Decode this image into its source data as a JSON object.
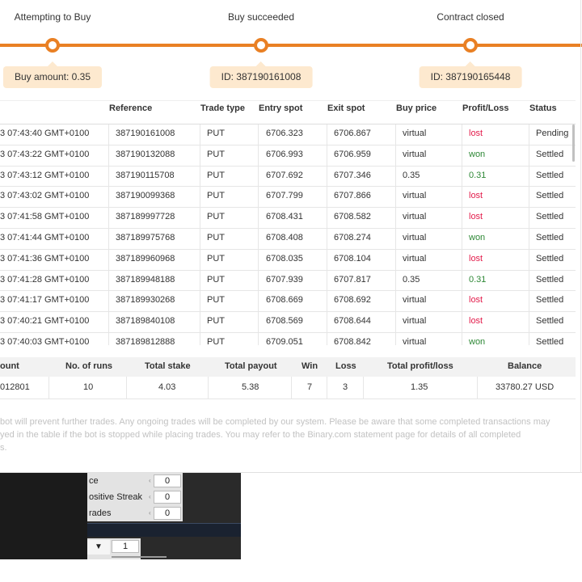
{
  "tracker": {
    "steps": [
      {
        "title": "Attempting to Buy",
        "bubble": "Buy amount: 0.35"
      },
      {
        "title": "Buy succeeded",
        "bubble": "ID: 387190161008"
      },
      {
        "title": "Contract closed",
        "bubble": "ID: 387190165448"
      }
    ],
    "accent_color": "#e98024"
  },
  "transactions": {
    "headers": [
      "Reference",
      "Trade type",
      "Entry spot",
      "Exit spot",
      "Buy price",
      "Profit/Loss",
      "Status"
    ],
    "rows": [
      {
        "timestamp": "3 07:43:40 GMT+0100",
        "reference": "387190161008",
        "trade_type": "PUT",
        "entry_spot": "6706.323",
        "exit_spot": "6706.867",
        "buy_price": "virtual",
        "profit_loss": "lost",
        "status": "Pending"
      },
      {
        "timestamp": "3 07:43:22 GMT+0100",
        "reference": "387190132088",
        "trade_type": "PUT",
        "entry_spot": "6706.993",
        "exit_spot": "6706.959",
        "buy_price": "virtual",
        "profit_loss": "won",
        "status": "Settled"
      },
      {
        "timestamp": "3 07:43:12 GMT+0100",
        "reference": "387190115708",
        "trade_type": "PUT",
        "entry_spot": "6707.692",
        "exit_spot": "6707.346",
        "buy_price": "0.35",
        "profit_loss": "0.31",
        "status": "Settled"
      },
      {
        "timestamp": "3 07:43:02 GMT+0100",
        "reference": "387190099368",
        "trade_type": "PUT",
        "entry_spot": "6707.799",
        "exit_spot": "6707.866",
        "buy_price": "virtual",
        "profit_loss": "lost",
        "status": "Settled"
      },
      {
        "timestamp": "3 07:41:58 GMT+0100",
        "reference": "387189997728",
        "trade_type": "PUT",
        "entry_spot": "6708.431",
        "exit_spot": "6708.582",
        "buy_price": "virtual",
        "profit_loss": "lost",
        "status": "Settled"
      },
      {
        "timestamp": "3 07:41:44 GMT+0100",
        "reference": "387189975768",
        "trade_type": "PUT",
        "entry_spot": "6708.408",
        "exit_spot": "6708.274",
        "buy_price": "virtual",
        "profit_loss": "won",
        "status": "Settled"
      },
      {
        "timestamp": "3 07:41:36 GMT+0100",
        "reference": "387189960968",
        "trade_type": "PUT",
        "entry_spot": "6708.035",
        "exit_spot": "6708.104",
        "buy_price": "virtual",
        "profit_loss": "lost",
        "status": "Settled"
      },
      {
        "timestamp": "3 07:41:28 GMT+0100",
        "reference": "387189948188",
        "trade_type": "PUT",
        "entry_spot": "6707.939",
        "exit_spot": "6707.817",
        "buy_price": "0.35",
        "profit_loss": "0.31",
        "status": "Settled"
      },
      {
        "timestamp": "3 07:41:17 GMT+0100",
        "reference": "387189930268",
        "trade_type": "PUT",
        "entry_spot": "6708.669",
        "exit_spot": "6708.692",
        "buy_price": "virtual",
        "profit_loss": "lost",
        "status": "Settled"
      },
      {
        "timestamp": "3 07:40:21 GMT+0100",
        "reference": "387189840108",
        "trade_type": "PUT",
        "entry_spot": "6708.569",
        "exit_spot": "6708.644",
        "buy_price": "virtual",
        "profit_loss": "lost",
        "status": "Settled"
      },
      {
        "timestamp": "3 07:40:03 GMT+0100",
        "reference": "387189812888",
        "trade_type": "PUT",
        "entry_spot": "6709.051",
        "exit_spot": "6708.842",
        "buy_price": "virtual",
        "profit_loss": "won",
        "status": "Settled"
      }
    ],
    "lost_color": "#e31c4b",
    "won_color": "#2e8836"
  },
  "summary": {
    "headers": {
      "account": "ount",
      "runs": "No. of runs",
      "stake": "Total stake",
      "payout": "Total payout",
      "win": "Win",
      "loss": "Loss",
      "profit": "Total profit/loss",
      "balance": "Balance"
    },
    "values": {
      "account": "012801",
      "runs": "10",
      "stake": "4.03",
      "payout": "5.38",
      "win": "7",
      "loss": "3",
      "profit": "1.35",
      "balance": "33780.27 USD"
    }
  },
  "notice": {
    "line1": "bot will prevent further trades. Any ongoing trades will be completed by our system. Please be aware that some completed transactions may",
    "line2": "yed in the table if the bot is stopped while placing trades. You may refer to the Binary.com statement page for details of all completed",
    "line3": "s."
  },
  "workspace": {
    "fields": [
      {
        "label": "ce",
        "value": "0"
      },
      {
        "label": "ositive Streak",
        "value": "0"
      },
      {
        "label": "rades",
        "value": "0"
      }
    ],
    "dropdown_icon": "triangle-down-icon",
    "dropdown_value": "1"
  }
}
